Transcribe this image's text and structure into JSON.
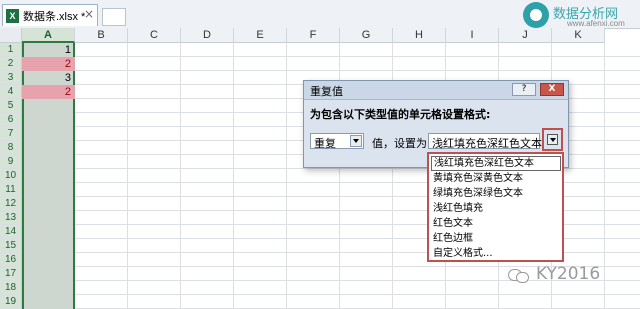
{
  "tab": {
    "label": "数据条.xlsx *",
    "close_glyph": "×",
    "icon_text": "X"
  },
  "watermark_top": {
    "name": "数据分析网",
    "url": "www.afenxi.com"
  },
  "partial_text": "K",
  "columns": [
    "A",
    "B",
    "C",
    "D",
    "E",
    "F",
    "G",
    "H",
    "I",
    "J",
    "K"
  ],
  "rows": [
    "1",
    "2",
    "3",
    "4",
    "5",
    "6",
    "7",
    "8",
    "9",
    "10",
    "11",
    "12",
    "13",
    "14",
    "15",
    "16",
    "17",
    "18",
    "19"
  ],
  "column_a_values": [
    {
      "row": "1",
      "value": "1",
      "duplicate": false
    },
    {
      "row": "2",
      "value": "2",
      "duplicate": true
    },
    {
      "row": "3",
      "value": "3",
      "duplicate": false
    },
    {
      "row": "4",
      "value": "2",
      "duplicate": true
    }
  ],
  "dialog": {
    "title": "重复值",
    "help_label": "?",
    "close_label": "X",
    "prompt": "为包含以下类型值的单元格设置格式:",
    "type_value": "重复",
    "middle_text": "值，设置为",
    "format_value": "浅红填充色深红色文本"
  },
  "dropdown_options": [
    "浅红填充色深红色文本",
    "黄填充色深黄色文本",
    "绿填充色深绿色文本",
    "浅红色填充",
    "红色文本",
    "红色边框",
    "自定义格式..."
  ],
  "watermark_bottom": {
    "handle": "KY2016"
  },
  "colors": {
    "duplicate_fill": "#e6a3ad",
    "duplicate_text": "#9c0006",
    "highlight_border": "#c0504d",
    "selection": "#2e7a43"
  }
}
